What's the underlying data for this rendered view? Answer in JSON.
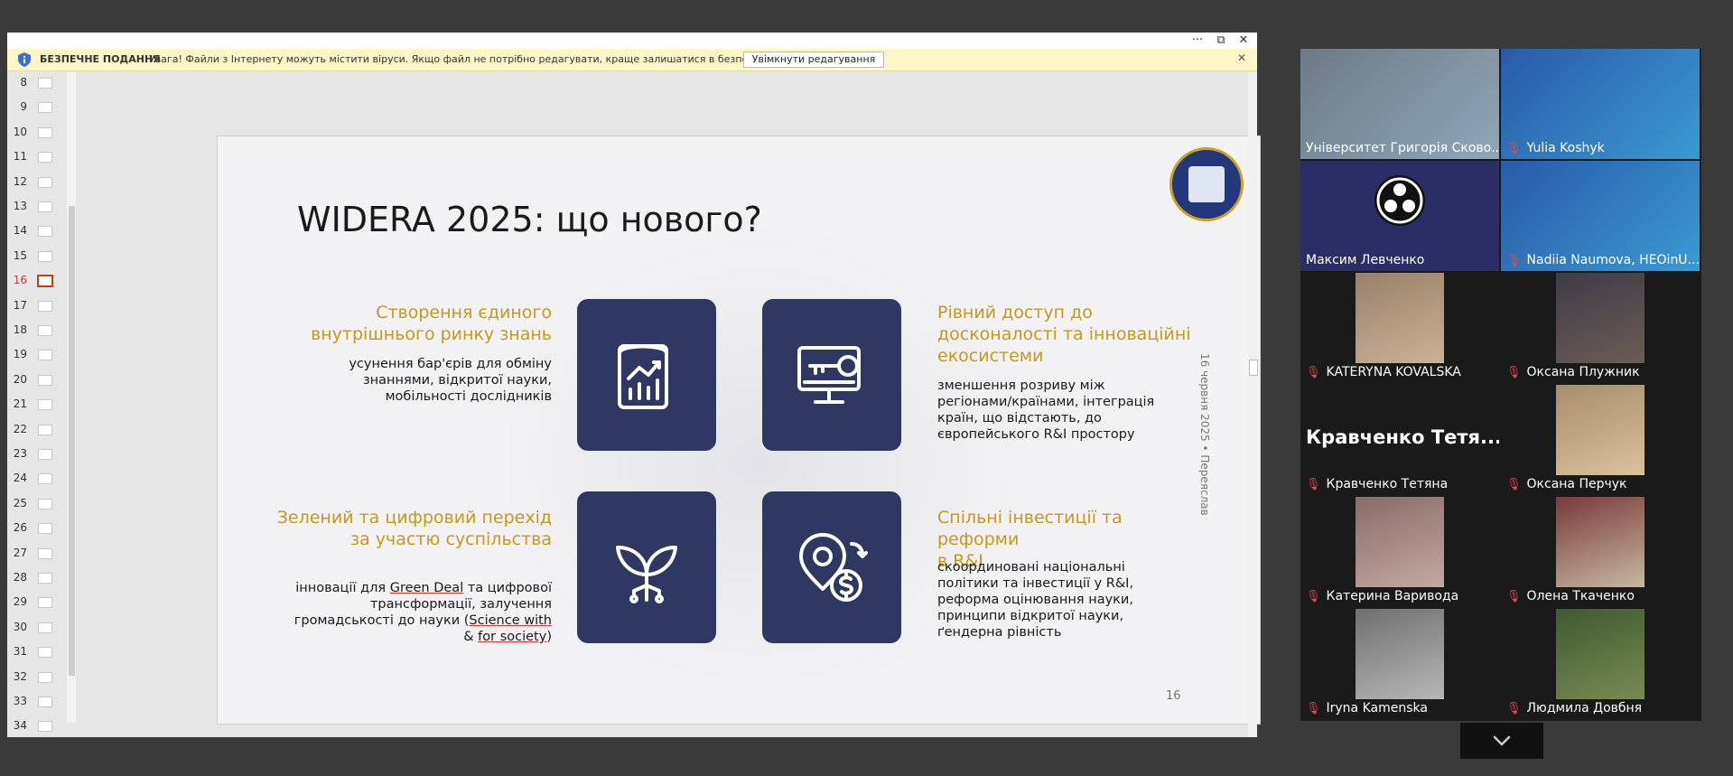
{
  "window": {
    "title_buttons": [
      "···",
      "⧉",
      "✕"
    ]
  },
  "infobar": {
    "title": "БЕЗПЕЧНЕ ПОДАННЯ",
    "message": "Увага! Файли з Інтернету можуть містити віруси. Якщо файл не потрібно редагувати, краще залишатися в безпечному поданні.",
    "button": "Увімкнути редагування",
    "close": "✕"
  },
  "thumbnails": {
    "numbers": [
      "8",
      "9",
      "10",
      "11",
      "12",
      "13",
      "14",
      "15",
      "16",
      "17",
      "18",
      "19",
      "20",
      "21",
      "22",
      "23",
      "24",
      "25",
      "26",
      "27",
      "28",
      "29",
      "30",
      "31",
      "32",
      "33",
      "34"
    ],
    "active": "16"
  },
  "slide": {
    "title": "WIDERA 2025: що нового?",
    "side_text": "16 червня 2025 • Переяслав",
    "number": "16",
    "blocks": {
      "b1": {
        "heading_l1": "Створення єдиного",
        "heading_l2": "внутрішнього ринку знань",
        "text_l1": "усунення бар'єрів для обміну",
        "text_l2": "знаннями, відкритої науки,",
        "text_l3": "мобільності дослідників"
      },
      "b2": {
        "heading_l1": "Рівний доступ до",
        "heading_l2": "досконалості та інноваційні",
        "heading_l3": "екосистеми",
        "text_l1": "зменшення розриву між",
        "text_l2": "регіонами/країнами, інтеграція",
        "text_l3": "країн, що відстають, до",
        "text_l4": "європейського R&I простору"
      },
      "b3": {
        "heading_l1": "Зелений та цифровий перехід",
        "heading_l2": "за участю суспільства",
        "text_l1a": "інновації для ",
        "text_l1b": "Green Deal",
        "text_l1c": " та цифрової",
        "text_l2": "трансформації, залучення",
        "text_l3a": "громадськості до науки (",
        "text_l3b": "Science with",
        "text_l4a": "& ",
        "text_l4b": "for society",
        "text_l4c": ")"
      },
      "b4": {
        "heading_l1": "Спільні інвестиції та реформи",
        "heading_l2": "в R&I",
        "text_l1": "скоординовані національні",
        "text_l2": "політики та інвестиції у R&I,",
        "text_l3": "реформа оцінювання науки,",
        "text_l4": "принципи відкритої науки,",
        "text_l5": "ґендерна рівність"
      }
    },
    "icons": [
      "report-chart-icon",
      "monitor-key-icon",
      "plant-circuit-icon",
      "idea-dollar-icon"
    ]
  },
  "participants": [
    {
      "name": "Університет Григорія Сково...",
      "muted": false,
      "active_speaker": true
    },
    {
      "name": "Yulia Koshyk",
      "muted": true
    },
    {
      "name": "Максим Левченко",
      "muted": false
    },
    {
      "name": "Nadiia Naumova, HEOinU...",
      "muted": true
    },
    {
      "name": "KATERYNA KOVALSKA",
      "muted": true
    },
    {
      "name": "Оксана Плужник",
      "muted": true
    },
    {
      "name": "Кравченко Тетяна",
      "muted": true,
      "display_text": "Кравченко  Тетя..."
    },
    {
      "name": "Оксана Перчук",
      "muted": true
    },
    {
      "name": "Катерина Варивода",
      "muted": true
    },
    {
      "name": "Олена Ткаченко",
      "muted": true
    },
    {
      "name": "Iryna Kamenska",
      "muted": true
    },
    {
      "name": "Людмила Довбня",
      "muted": true
    }
  ],
  "colors": {
    "tile": "#2f3863",
    "heading": "#c49a1c",
    "active_speaker_border": "#22c55e",
    "muted_mic": "#e0484e"
  }
}
